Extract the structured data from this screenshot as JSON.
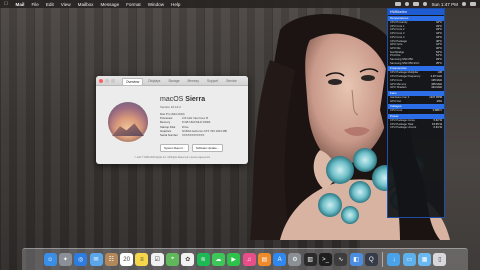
{
  "menubar": {
    "apple_icon": "apple-icon",
    "items": [
      "Mail",
      "File",
      "Edit",
      "View",
      "Mailbox",
      "Message",
      "Format",
      "Window",
      "Help"
    ],
    "clock": "Sun 1:47 PM"
  },
  "about_window": {
    "tabs": [
      "Overview",
      "Displays",
      "Storage",
      "Memory",
      "Support",
      "Service"
    ],
    "os_name_light": "macOS",
    "os_name_bold": "Sierra",
    "version": "Version 10.12.2",
    "specs": [
      {
        "label": "Mac Pro (Mid 2010)",
        "value": ""
      },
      {
        "label": "Processor",
        "value": "2.8 GHz Intel Core i5"
      },
      {
        "label": "Memory",
        "value": "8 GB 1600 MHz DDR3"
      },
      {
        "label": "Startup Disk",
        "value": "Drive"
      },
      {
        "label": "Graphics",
        "value": "NVIDIA GeForce GTX 760 1023 MB"
      },
      {
        "label": "Serial Number",
        "value": "XXXXXXXXXXXX"
      }
    ],
    "buttons": [
      "System Report...",
      "Software Update..."
    ],
    "footer": "™ and © 1983-2016 Apple Inc. All Rights Reserved. License Agreement"
  },
  "hwmonitor": {
    "title": "HWMonitor",
    "sections": [
      {
        "name": "Temperatures",
        "rows": [
          [
            "CPU Proximity",
            "42°C"
          ],
          [
            "CPU Core 1",
            "43°C"
          ],
          [
            "CPU Core 2",
            "43°C"
          ],
          [
            "CPU Core 3",
            "44°C"
          ],
          [
            "CPU Core 4",
            "43°C"
          ],
          [
            "CPU Package",
            "46°C"
          ],
          [
            "GPU Core",
            "41°C"
          ],
          [
            "GPU Die",
            "40°C"
          ],
          [
            "Northbridge",
            "54°C"
          ],
          [
            "PCH Die",
            "51°C"
          ],
          [
            "Samsung SSD 850",
            "33°C"
          ],
          [
            "Samsung SSD 850 EVO",
            "35°C"
          ]
        ]
      },
      {
        "name": "Frequencies",
        "rows": [
          [
            "CPU Package Multiplier",
            "x30"
          ],
          [
            "CPU Package Frequency",
            "2.97 GHz"
          ],
          [
            "CPU Core",
            "135 MHz"
          ],
          [
            "GPU Memory",
            "405 MHz"
          ],
          [
            "GPU Shaders",
            "324 MHz"
          ]
        ]
      },
      {
        "name": "Fans",
        "rows": [
          [
            "Hardware Fan 0",
            "1337 RPM"
          ],
          [
            "GPU Fan",
            "29%"
          ]
        ]
      },
      {
        "name": "Voltages",
        "rows": [
          [
            "CPU Core",
            "0.888 V"
          ]
        ]
      },
      {
        "name": "Power",
        "rows": [
          [
            "CPU Package Cores",
            "5.62 W"
          ],
          [
            "CPU Package Total",
            "15.65 W"
          ],
          [
            "CPU Package Uncore",
            "0.34 W"
          ]
        ]
      }
    ]
  },
  "dock": {
    "apps": [
      {
        "name": "finder",
        "color": "#3a8ee6",
        "glyph": "☺"
      },
      {
        "name": "launchpad",
        "color": "#8a8f98",
        "glyph": "✦"
      },
      {
        "name": "safari",
        "color": "#2d7de0",
        "glyph": "◎"
      },
      {
        "name": "mail",
        "color": "#5aa6e8",
        "glyph": "✉"
      },
      {
        "name": "contacts",
        "color": "#b2875a",
        "glyph": "☷"
      },
      {
        "name": "calendar",
        "color": "#ffffff",
        "glyph": "20"
      },
      {
        "name": "notes",
        "color": "#f5d64a",
        "glyph": "≡"
      },
      {
        "name": "reminders",
        "color": "#f1f1f1",
        "glyph": "☑"
      },
      {
        "name": "maps",
        "color": "#5fb85a",
        "glyph": "⌖"
      },
      {
        "name": "photos",
        "color": "#f2f2f2",
        "glyph": "✿"
      },
      {
        "name": "spotify",
        "color": "#1db954",
        "glyph": "≋"
      },
      {
        "name": "messages",
        "color": "#3fc659",
        "glyph": "☁"
      },
      {
        "name": "facetime",
        "color": "#2ec24b",
        "glyph": "▶"
      },
      {
        "name": "itunes",
        "color": "#e84f8a",
        "glyph": "♫"
      },
      {
        "name": "ibooks",
        "color": "#f08a2a",
        "glyph": "▤"
      },
      {
        "name": "app-store",
        "color": "#2f88ee",
        "glyph": "A"
      },
      {
        "name": "system-preferences",
        "color": "#8b8f96",
        "glyph": "⚙"
      },
      {
        "name": "hwmonitor",
        "color": "#2a2a2a",
        "glyph": "▥"
      },
      {
        "name": "terminal",
        "color": "#1e1e1e",
        "glyph": ">_"
      },
      {
        "name": "activity-monitor",
        "color": "#3c3c3c",
        "glyph": "∿"
      },
      {
        "name": "preview",
        "color": "#4b8de0",
        "glyph": "◧"
      },
      {
        "name": "quicktime",
        "color": "#353b48",
        "glyph": "Q"
      }
    ],
    "right_items": [
      {
        "name": "downloads-stack",
        "color": "#4aa3e8",
        "glyph": "↓"
      },
      {
        "name": "documents-stack",
        "color": "#5db0ec",
        "glyph": "▭"
      },
      {
        "name": "applications-stack",
        "color": "#6ab8f0",
        "glyph": "▦"
      },
      {
        "name": "trash",
        "color": "#d8d8dc",
        "glyph": "▯"
      }
    ]
  }
}
